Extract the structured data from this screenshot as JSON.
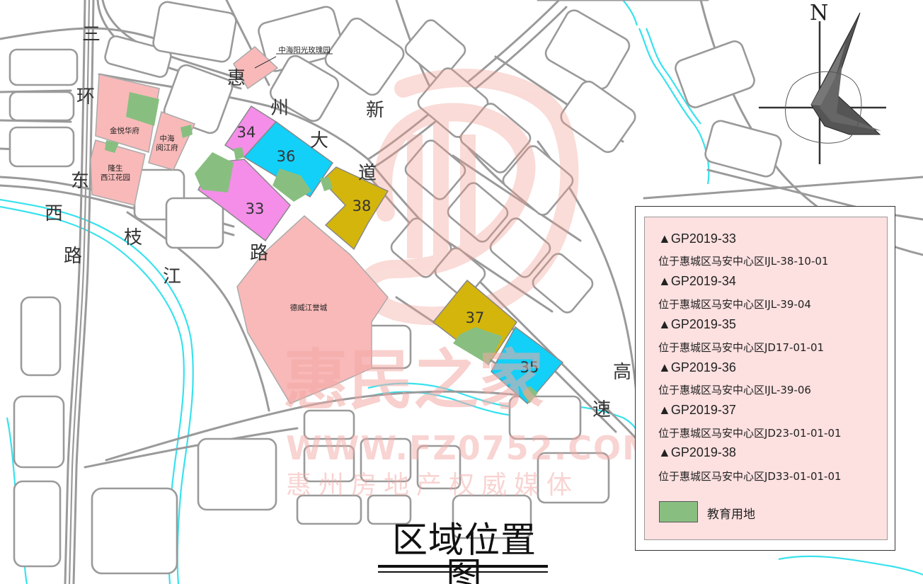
{
  "map": {
    "north_label": "N",
    "title": "区域位置图",
    "road_chars": [
      "三",
      "环",
      "东",
      "路",
      "惠",
      "州",
      "大",
      "道",
      "新",
      "西",
      "枝",
      "江",
      "路",
      "高",
      "速"
    ],
    "place_labels": {
      "zhonghai_yangguang": "中海阳光玫瑰园",
      "jinyue_huafu": "金悦华府",
      "zhonghai_yuejiang_1": "中海",
      "zhonghai_yuejiang_2": "阅江府",
      "longsheng_1": "隆生",
      "longsheng_2": "西江花园",
      "dewei": "德威江誉城"
    },
    "parcels": [
      {
        "id": "33",
        "color": "#f48ee8"
      },
      {
        "id": "34",
        "color": "#f48ee8"
      },
      {
        "id": "35",
        "color": "#12d0f8"
      },
      {
        "id": "36",
        "color": "#12d0f8"
      },
      {
        "id": "37",
        "color": "#d4b50c"
      },
      {
        "id": "38",
        "color": "#d4b50c"
      }
    ],
    "colors": {
      "residential_pink": "#f9b9b9",
      "education_green": "#88bf80",
      "river": "#38e2ee",
      "road": "#9a9a9a"
    }
  },
  "legend": {
    "entries": [
      {
        "code": "▲GP2019-33",
        "location": "位于惠城区马安中心区IJL-38-10-01"
      },
      {
        "code": "▲GP2019-34",
        "location": "位于惠城区马安中心区IJL-39-04"
      },
      {
        "code": "▲GP2019-35",
        "location": "位于惠城区马安中心区JD17-01-01"
      },
      {
        "code": "▲GP2019-36",
        "location": "位于惠城区马安中心区IJL-39-06"
      },
      {
        "code": "▲GP2019-37",
        "location": "位于惠城区马安中心区JD23-01-01-01"
      },
      {
        "code": "▲GP2019-38",
        "location": "位于惠城区马安中心区JD33-01-01-01"
      }
    ],
    "key_label": "教育用地"
  },
  "watermark": {
    "name": "惠民之家",
    "url": "WWW.FZ0752.COM",
    "slogan": "惠州房地产权威媒体"
  }
}
